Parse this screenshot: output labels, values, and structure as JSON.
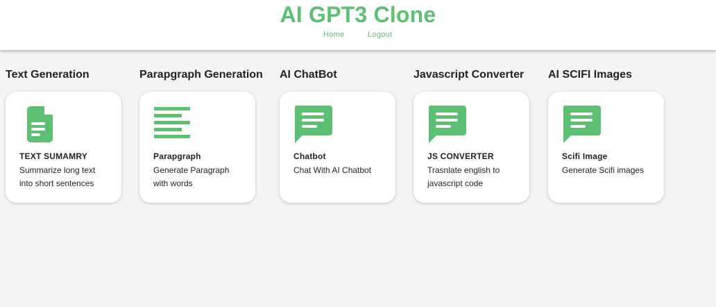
{
  "header": {
    "title": "AI GPT3 Clone",
    "nav": {
      "home": "Home",
      "logout": "Logout"
    }
  },
  "accent_color": "#5cbf72",
  "sections": [
    {
      "title": "Text Generation",
      "card": {
        "icon": "document-icon",
        "heading": "TEXT SUMAMRY",
        "desc": "Summarize long text into short sentences"
      }
    },
    {
      "title": "Parapgraph Generation",
      "card": {
        "icon": "paragraph-lines-icon",
        "heading": "Parapgraph",
        "desc": "Generate Paragraph with words"
      }
    },
    {
      "title": "AI ChatBot",
      "card": {
        "icon": "chat-bubble-icon",
        "heading": "Chatbot",
        "desc": "Chat With AI Chatbot"
      }
    },
    {
      "title": "Javascript Converter",
      "card": {
        "icon": "chat-bubble-icon",
        "heading": "JS CONVERTER",
        "desc": "Trasnlate english to javascript code"
      }
    },
    {
      "title": "AI SCIFI Images",
      "card": {
        "icon": "chat-bubble-icon",
        "heading": "Scifi Image",
        "desc": "Generate Scifi images"
      }
    }
  ]
}
